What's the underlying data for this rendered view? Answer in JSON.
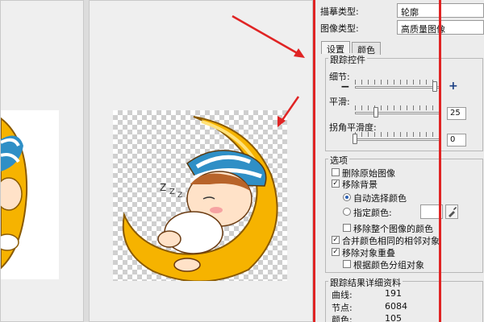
{
  "options": {
    "tracing_type_label": "描摹类型:",
    "tracing_type_value": "轮廓",
    "image_type_label": "图像类型:",
    "image_type_value": "高质量图像"
  },
  "tabs": [
    {
      "label": "设置",
      "active": true
    },
    {
      "label": "颜色",
      "active": false
    }
  ],
  "tracing_controls": {
    "title": "跟踪控件",
    "detail_label": "细节:",
    "detail_value_fraction": 0.93,
    "smoothing_label": "平滑:",
    "smoothing_value": "25",
    "corner_label": "拐角平滑度:",
    "corner_value": "0"
  },
  "choices": {
    "title": "选项",
    "delete_original": {
      "label": "删除原始图像",
      "checked": false
    },
    "remove_background": {
      "label": "移除背景",
      "checked": true
    },
    "auto_color": {
      "label": "自动选择颜色",
      "selected": true
    },
    "specify_color": {
      "label": "指定颜色:",
      "selected": false
    },
    "remove_whole_color": {
      "label": "移除整个图像的颜色",
      "checked": false
    },
    "merge_adjacent": {
      "label": "合并颜色相同的相邻对象",
      "checked": true
    },
    "remove_overlap": {
      "label": "移除对象重叠",
      "checked": true
    },
    "group_by_color": {
      "label": "根据颜色分组对象",
      "checked": false
    }
  },
  "details": {
    "title": "跟踪结果详细资料",
    "curves_label": "曲线:",
    "curves_value": "191",
    "nodes_label": "节点:",
    "nodes_value": "6084",
    "colors_label": "颜色:",
    "colors_value": "105"
  },
  "colors": {
    "annotation_red": "#e02424",
    "moon_yellow": "#f6b300",
    "cap_stripe": "#2f8fc6"
  }
}
